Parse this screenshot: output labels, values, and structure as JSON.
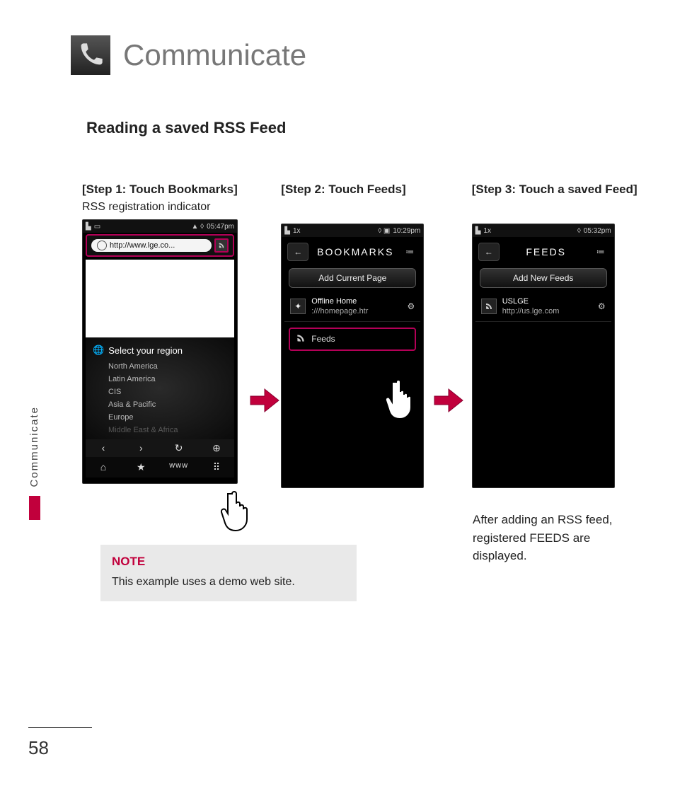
{
  "chapter": {
    "title": "Communicate"
  },
  "section": {
    "title": "Reading a saved RSS Feed"
  },
  "sideTab": {
    "label": "Communicate"
  },
  "pageNumber": "58",
  "steps": {
    "s1": {
      "label": "[Step 1: Touch Bookmarks]",
      "sub": "RSS registration indicator",
      "status_time": "05:47pm",
      "url": "http://www.lge.co...",
      "region_title": "Select your region",
      "regions": [
        "North America",
        "Latin America",
        "CIS",
        "Asia & Pacific",
        "Europe",
        "Middle East & Africa"
      ],
      "nav": {
        "back": "‹",
        "fwd": "›",
        "reload": "↻",
        "zoom": "⊕",
        "home": "⌂",
        "star": "★",
        "www": "www",
        "grid": "⠿"
      }
    },
    "s2": {
      "label": "[Step 2: Touch Feeds]",
      "status_time": "10:29pm",
      "header": "BOOKMARKS",
      "add_btn": "Add Current Page",
      "item_title": "Offline Home",
      "item_sub": ":///homepage.htr",
      "feeds_label": "Feeds"
    },
    "s3": {
      "label": "[Step 3: Touch a saved Feed]",
      "status_time": "05:32pm",
      "header": "FEEDS",
      "add_btn": "Add New Feeds",
      "item_title": "USLGE",
      "item_sub": "http://us.lge.com",
      "caption": "After adding an RSS feed, registered FEEDS are displayed."
    }
  },
  "note": {
    "label": "NOTE",
    "text": "This example uses a demo web site."
  }
}
